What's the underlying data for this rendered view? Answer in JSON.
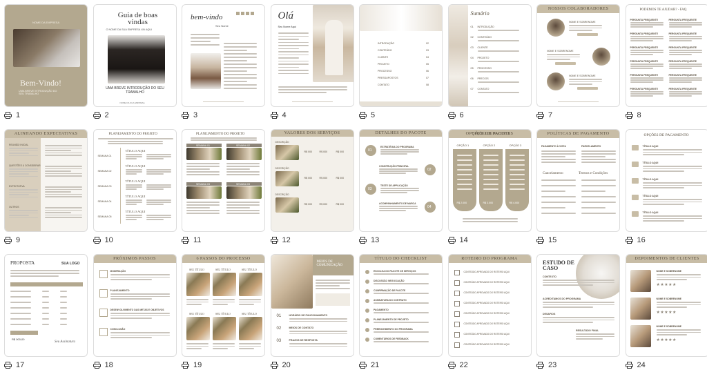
{
  "pages": [
    {
      "n": "1",
      "title": "Bem-Vindo!",
      "subtitle": "UMA BREVE INTRODUÇÃO DO SEU TRABALHO",
      "top": "NOME DA EMPRESA"
    },
    {
      "n": "2",
      "title": "Guia de boas vindas",
      "subtitle": "UMA BREVE INTRODUÇÃO DO SEU TRABALHO",
      "top": "O NOME DA SUA EMPRESA VAI AQUI"
    },
    {
      "n": "3",
      "title": "bem-vindo",
      "subtitle": "Seu Nome"
    },
    {
      "n": "4",
      "title": "Olá",
      "subtitle": "Seu Nome Aqui"
    },
    {
      "n": "5",
      "title": "Índice de Conteúdo",
      "items": [
        "INTRODUÇÃO",
        "CONTEÚDO",
        "CLIENTE",
        "PROJETO",
        "PROCESSO",
        "PRESSUPOSTOS",
        "CONTATO"
      ],
      "nums": [
        "02",
        "03",
        "04",
        "05",
        "06",
        "07",
        "08"
      ]
    },
    {
      "n": "6",
      "title": "Sumário",
      "nums": [
        "01",
        "02",
        "03",
        "04",
        "05",
        "06",
        "07"
      ],
      "items": [
        "INTRODUÇÃO",
        "CONTEÚDO",
        "CLIENTE",
        "PROJETO",
        "PROCESSO",
        "PRECIOS",
        "CONTATO"
      ]
    },
    {
      "n": "7",
      "title": "NOSSOS COLABORADORES",
      "items": [
        "NOME E SOBRENOME",
        "NOME E SOBRENOME",
        "NOME E SOBRENOME"
      ]
    },
    {
      "n": "8",
      "title": "PODEMOS TE AJUDAR? - FAQ",
      "items": [
        "PERGUNTA FREQUENTE"
      ]
    },
    {
      "n": "9",
      "title": "ALINHANDO EXPECTATIVAS",
      "items": [
        "REUNIÃO INICIAL",
        "QUESTÕES & CONSIDERAR",
        "EXPECTATIVA",
        "OUTROS"
      ]
    },
    {
      "n": "10",
      "title": "PLANEJAMENTO DO PROJETO",
      "items": [
        "SEMANA 01",
        "SEMANA 02",
        "SEMANA 03",
        "SEMANA 04",
        "SEMANA 05"
      ],
      "label": "TÍTULO AQUI"
    },
    {
      "n": "11",
      "title": "PLANEJAMENTO DO PROJETO",
      "items": [
        "SEMANA 01",
        "SEMANA 02",
        "SEMANA 03",
        "SEMANA 03"
      ]
    },
    {
      "n": "12",
      "title": "VALORES DOS SERVIÇOS",
      "prices": [
        "R$ 000",
        "R$ 000",
        "R$ 000"
      ]
    },
    {
      "n": "13",
      "title": "DETALHES DO PACOTE",
      "items": [
        "ESTRATÉGIA DO PROGRAMA",
        "CONSTRUÇÃO PRINCIPAL",
        "TESTE DE APPLICAÇÃO",
        "ACOMPANHAMENTO DE MARCA"
      ],
      "nums": [
        "01",
        "02",
        "03",
        "04"
      ]
    },
    {
      "n": "14",
      "title": "OPÇÕES DE PACOTES",
      "items": [
        "OPÇÃO 1",
        "OPÇÃO 2",
        "OPÇÃO 3"
      ],
      "prices": [
        "R$ 2.000",
        "R$ 3.000",
        "R$ 4.000"
      ]
    },
    {
      "n": "15",
      "title": "POLÍTICAS DE PAGAMENTO",
      "items": [
        "PAGAMENTO À VISTA",
        "PARCELAMENTO",
        "Cancelamento",
        "Termos e Condições"
      ]
    },
    {
      "n": "16",
      "title": "OPÇÕES DE PAGAMENTO",
      "items": [
        "TÍTULO AQUI",
        "TÍTULO AQUI",
        "TÍTULO AQUI",
        "TÍTULO AQUI",
        "TÍTULO AQUI"
      ]
    },
    {
      "n": "17",
      "title": "PROPOSTA",
      "brand": "SUA LOGO",
      "total": "R$ 000,00",
      "signature": "Seu Assinatura"
    },
    {
      "n": "18",
      "title": "PRÓXIMOS PASSOS",
      "items": [
        "MODERAÇÃO",
        "PLANEJAMENTO",
        "DESENVOLVIMENTO DAS METAS E OBJETIVOS",
        "CONCLUSÃO"
      ]
    },
    {
      "n": "19",
      "title": "6 PASSOS DO PROCESSO",
      "items": [
        "SEU TÍTULO",
        "SEU TÍTULO",
        "SEU TÍTULO",
        "SEU TÍTULO",
        "SEU TÍTULO",
        "SEU TÍTULO"
      ]
    },
    {
      "n": "20",
      "title": "MEIOS DE COMUNICAÇÃO",
      "items": [
        "HORÁRIO DE FUNCIONAMENTO",
        "MEIOS DE CONTATO",
        "PRAZOS DE RESPOSTA"
      ],
      "nums": [
        "01",
        "02",
        "03"
      ]
    },
    {
      "n": "21",
      "title": "TÍTULO DO CHECKLIST",
      "items": [
        "ESCOLHA DO PACOTE DE SERVIÇOS",
        "DISCUSSÃO NEGOCIAÇÃO",
        "CONFIRMAÇÃO DE PACOTE",
        "ASSINATURA DO CONTRATO",
        "PAGAMENTO",
        "PLANEJAMENTO DE PROJETO",
        "PREENCHIMENTO DO PROGRAMA",
        "COMENTÁRIOS DE FEEDBACK"
      ]
    },
    {
      "n": "22",
      "title": "ROTEIRO DO PROGRAMA",
      "items": [
        "CONTEÚDO APROVADO DO ROTEIRO AQUI"
      ]
    },
    {
      "n": "23",
      "title": "ESTUDO DE CASO",
      "items": [
        "CONTEXTO",
        "ACREDITAMOS DO PROGRAMA",
        "DESAFIOS",
        "RESULTADO FINAL"
      ]
    },
    {
      "n": "24",
      "title": "DEPOIMENTOS DE CLIENTES",
      "items": [
        "NOME E SOBRENOME",
        "NOME E SOBRENOME",
        "NOME E SOBRENOME"
      ],
      "stars": "★★★★★"
    }
  ],
  "icons": {
    "print": "print-icon"
  },
  "colors": {
    "beige": "#c8bda6",
    "taupe": "#b3a88f",
    "text": "#5a5040",
    "paper": "#ffffff",
    "photo_dark": "#6b5a45",
    "photo_light": "#d9cfc0"
  }
}
